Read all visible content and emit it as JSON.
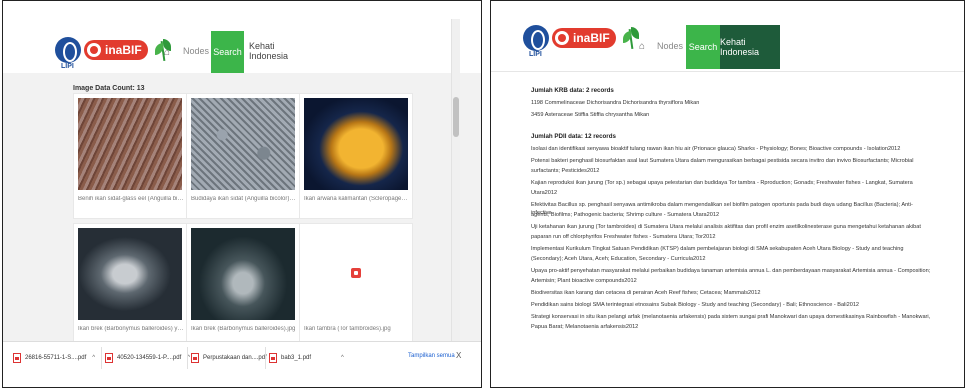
{
  "left": {
    "nav": {
      "home_icon": "home-icon",
      "nodes": "Nodes",
      "search": "Search"
    },
    "logo_text": {
      "lipi": "LIPI",
      "inabif": "inaBIF"
    },
    "image_count_label": "Image Data Count: 13",
    "images": [
      {
        "caption": "Benih ikan sidat-glass eel (Anguilla bicolor).jpg"
      },
      {
        "caption": "Budidaya ikan sidat (Anguilla bicolor) dalam ..."
      },
      {
        "caption": "Ikan arwana kalimantan (Scleropages formo..."
      },
      {
        "caption": "Ikan brek (Barbonymus balleroides) yang ba..."
      },
      {
        "caption": "Ikan brek (Barbonymus balleroides).jpg"
      },
      {
        "caption": "Ikan tambra (Tor tambroides).jpg"
      }
    ],
    "downloads": [
      {
        "name": "26816-55711-1-S....pdf"
      },
      {
        "name": "40520-134559-1-P....pdf"
      },
      {
        "name": "Perpustakaan dan....pdf"
      },
      {
        "name": "bab3_1.pdf"
      }
    ],
    "show_all": "Tampilkan semua",
    "close": "X"
  },
  "right": {
    "nav": {
      "home_icon": "home-icon",
      "nodes": "Nodes",
      "search": "Search",
      "kehati": "Kehati Indonesia"
    },
    "logo_text": {
      "lipi": "LIPI",
      "inabif": "inaBIF"
    },
    "krb_heading": "Jumlah KRB data: 2 records",
    "krb_lines": [
      "1198 Commelinaceae Dichorisandra Dichorisandra thyrsiflora Mikan",
      "3459 Asteraceae Stiffia Stiffia chrysantha Mikan"
    ],
    "pdii_heading": "Jumlah PDII data: 12 records",
    "pdii_lines": [
      "Isolasi dan identifikasi senyawa bioaktif tulang rawan ikan hiu air (Prionace glauca) Sharks - Physiology; Bones; Bioactive compounds - Isolation2012",
      "Potensi bakteri penghasil biosurfaktan asal laut Sumatera Utara dalam mengurasikan berbagai pestisida secara invitro dan invivo Biosurfactants; Microbial",
      "surfactants; Pesticides2012",
      "Kajian reproduksi ikan jurung (Tor sp.) sebagai upaya pelestarian dan budidaya Tor tambra - Rproduction; Gonads; Freshwater fishes - Langkat, Sumatera",
      "Utara2012",
      "Efektivitas Bacillus sp. penghasil senyawa antimikroba dalam mengendalikan sel biofilm patogen oportunis pada budi daya udang Bacillus (Bacteria); Anti-infective",
      "agents; Biofilms; Pathogenic bacteria; Shrimp culture - Sumatera Utara2012",
      "Uji ketahanan ikan jurung (Tor tambroides) di Sumatera Utara melalui analisis aktifitas dan profil enzim asetilkolinesterase guna mengetahui ketahanan akibat",
      "paparan run off chlorphyrifos Freshwater fishes - Sumatera Utara; Tor2012",
      "Implementasi Kurikulum Tingkat Satuan Pendidikan (KTSP) dalam pembelajaran biologi di SMA sekabupaten Aceh Utara Biology - Study and teaching",
      "(Secondary); Aceh Utara, Aceh; Education, Secondary - Curricula2012",
      "Upaya pro-aktif penyehatan masyarakat melalui perbaikan budidaya tanaman artemisia annua L. dan pemberdayaan masyarakat Artemisia annua - Composition;",
      "Artemisin; Plant bioactive compounds2012",
      "Biodiversitas ikan karang dan cetacea di perairan Aceh Reef fishes; Cetacea; Mammals2012",
      "Pendidikan sains biologi SMA terintegrasi etnosains Subak Biology - Study and teaching (Secondary) - Bali; Ethnoscience - Bali2012",
      "Strategi konservasi in situ ikan pelangi arfak (melanotaenia arfakensis) pada sistem sungai prafi Manokwari dan upaya domestikasinya Rainbowfish - Manokwari,",
      "Papua Barat; Melanotaenia arfakensis2012"
    ]
  },
  "colors": {
    "accent_green": "#3cb54a",
    "dark_green": "#1e5b3a",
    "logo_red": "#e23b2e",
    "logo_blue": "#1f4f9c",
    "link_blue": "#1a5fd0"
  }
}
